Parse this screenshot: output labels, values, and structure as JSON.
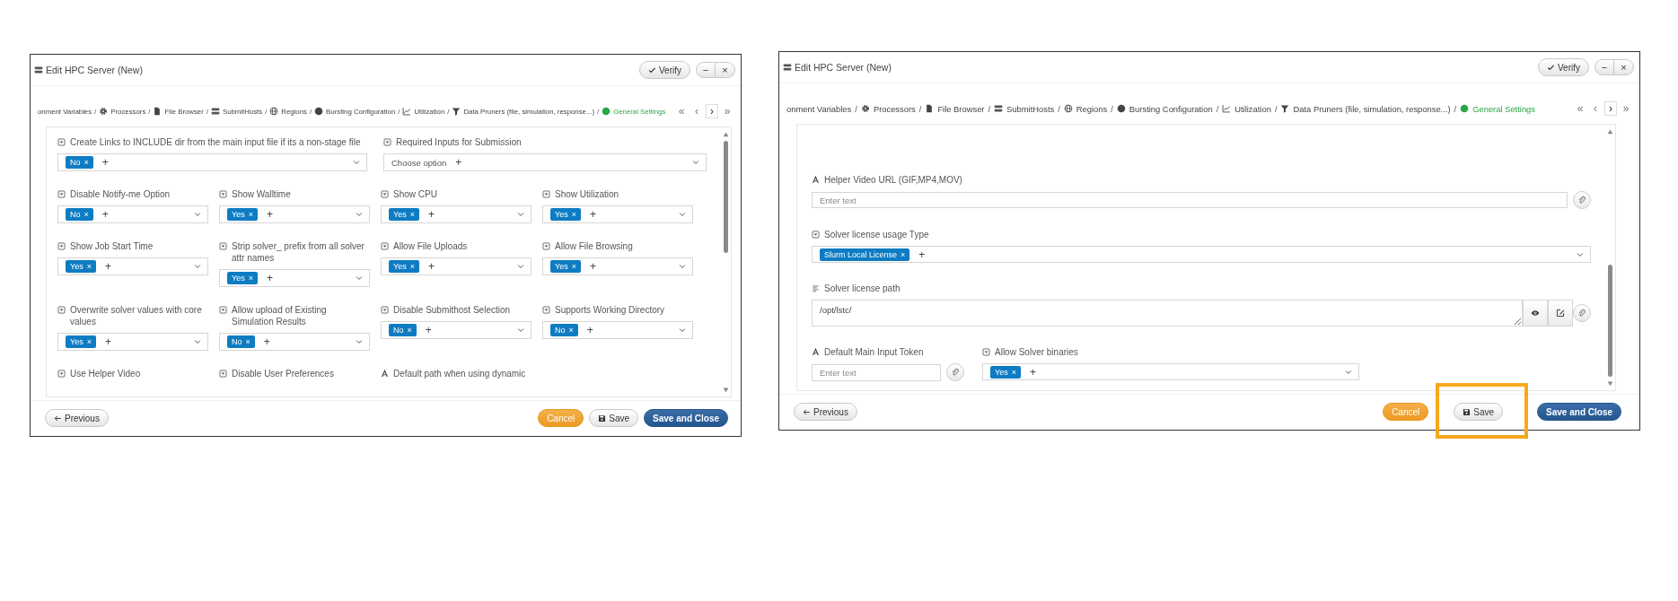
{
  "dialogs": [
    {
      "title": "Edit HPC Server (New)",
      "verify": "Verify",
      "window_controls": [
        "−",
        "×"
      ],
      "breadcrumb": [
        {
          "kind": "none",
          "label": "onment Variables",
          "separator": "/",
          "selected": false
        },
        {
          "kind": "gear",
          "label": "Processors",
          "separator": "/",
          "selected": false
        },
        {
          "kind": "file",
          "label": "File Browser",
          "separator": "/",
          "selected": false
        },
        {
          "kind": "server",
          "label": "SubmitHosts",
          "separator": "/",
          "selected": false
        },
        {
          "kind": "globe",
          "label": "Regions",
          "separator": "/",
          "selected": false
        },
        {
          "kind": "dot",
          "label": "Bursting Configuration",
          "separator": "/",
          "selected": false
        },
        {
          "kind": "chart",
          "label": "Utilization",
          "separator": "/",
          "selected": false
        },
        {
          "kind": "filter",
          "label": "Data Pruners (file, simulation, response...)",
          "separator": "/",
          "selected": false
        },
        {
          "kind": "dot",
          "label": "General Settings",
          "selected": true
        }
      ],
      "nav": [
        {
          "label": "«",
          "selected": false
        },
        {
          "label": "‹",
          "selected": false
        },
        {
          "label": "›",
          "selected": true
        },
        {
          "label": "»",
          "selected": false
        }
      ],
      "rows": [
        {
          "kind": "halves",
          "fields": [
            {
              "kind": "select",
              "label": "Create Links to INCLUDE dir from the main input file if its a non-stage file",
              "chips": [
                {
                  "label": "No",
                  "remove": "×"
                }
              ],
              "add": "+"
            },
            {
              "kind": "select",
              "label": "Required Inputs for Submission",
              "placeholder": "Choose option",
              "add": "+"
            }
          ]
        },
        {
          "kind": "quarters",
          "fields": [
            {
              "kind": "select",
              "label": "Disable Notify-me Option",
              "chips": [
                {
                  "label": "No",
                  "remove": "×"
                }
              ],
              "add": "+"
            },
            {
              "kind": "select",
              "label": "Show Walltime",
              "chips": [
                {
                  "label": "Yes",
                  "remove": "×"
                }
              ],
              "add": "+"
            },
            {
              "kind": "select",
              "label": "Show CPU",
              "chips": [
                {
                  "label": "Yes",
                  "remove": "×"
                }
              ],
              "add": "+"
            },
            {
              "kind": "select",
              "label": "Show Utilization",
              "chips": [
                {
                  "label": "Yes",
                  "remove": "×"
                }
              ],
              "add": "+"
            }
          ]
        },
        {
          "kind": "quarters",
          "fields": [
            {
              "kind": "select",
              "label": "Show Job Start Time",
              "chips": [
                {
                  "label": "Yes",
                  "remove": "×"
                }
              ],
              "add": "+"
            },
            {
              "kind": "select",
              "label": "Strip solver_ prefix from all solver attr names",
              "chips": [
                {
                  "label": "Yes",
                  "remove": "×"
                }
              ],
              "add": "+"
            },
            {
              "kind": "select",
              "label": "Allow File Uploads",
              "chips": [
                {
                  "label": "Yes",
                  "remove": "×"
                }
              ],
              "add": "+"
            },
            {
              "kind": "select",
              "label": "Allow File Browsing",
              "chips": [
                {
                  "label": "Yes",
                  "remove": "×"
                }
              ],
              "add": "+"
            }
          ]
        },
        {
          "kind": "quarters",
          "fields": [
            {
              "kind": "select",
              "label": "Overwrite solver values with core values",
              "chips": [
                {
                  "label": "Yes",
                  "remove": "×"
                }
              ],
              "add": "+"
            },
            {
              "kind": "select",
              "label": "Allow upload of Existing Simulation Results",
              "chips": [
                {
                  "label": "No",
                  "remove": "×"
                }
              ],
              "add": "+"
            },
            {
              "kind": "select",
              "label": "Disable Submithost Selection",
              "chips": [
                {
                  "label": "No",
                  "remove": "×"
                }
              ],
              "add": "+"
            },
            {
              "kind": "select",
              "label": "Supports Working Directory",
              "chips": [
                {
                  "label": "No",
                  "remove": "×"
                }
              ],
              "add": "+"
            }
          ]
        },
        {
          "kind": "quarters",
          "fields": [
            {
              "kind": "select",
              "label": "Use Helper Video"
            },
            {
              "kind": "select",
              "label": "Disable User Preferences"
            },
            {
              "kind": "text",
              "label": "Default path when using dynamic"
            }
          ]
        }
      ],
      "footer": {
        "previous": "Previous",
        "cancel": "Cancel",
        "save": {
          "label": "Save",
          "highlighted": false
        },
        "save_close": "Save and Close"
      }
    },
    {
      "title": "Edit HPC Server (New)",
      "verify": "Verify",
      "window_controls": [
        "−",
        "×"
      ],
      "breadcrumb": [
        {
          "kind": "none",
          "label": "onment Variables",
          "separator": "/",
          "selected": false
        },
        {
          "kind": "gear",
          "label": "Processors",
          "separator": "/",
          "selected": false
        },
        {
          "kind": "file",
          "label": "File Browser",
          "separator": "/",
          "selected": false
        },
        {
          "kind": "server",
          "label": "SubmitHosts",
          "separator": "/",
          "selected": false
        },
        {
          "kind": "globe",
          "label": "Regions",
          "separator": "/",
          "selected": false
        },
        {
          "kind": "dot",
          "label": "Bursting Configuration",
          "separator": "/",
          "selected": false
        },
        {
          "kind": "chart",
          "label": "Utilization",
          "separator": "/",
          "selected": false
        },
        {
          "kind": "filter",
          "label": "Data Pruners (file, simulation, response...)",
          "separator": "/",
          "selected": false
        },
        {
          "kind": "dot",
          "label": "General Settings",
          "selected": true
        }
      ],
      "nav": [
        {
          "label": "«",
          "selected": false
        },
        {
          "label": "‹",
          "selected": false
        },
        {
          "label": "›",
          "selected": true
        },
        {
          "label": "»",
          "selected": false
        }
      ],
      "rows": [
        {
          "kind": "full",
          "fields": [
            {
              "kind": "text",
              "label": "Helper Video URL (GIF,MP4,MOV)",
              "placeholder": "Enter text"
            }
          ]
        },
        {
          "kind": "full",
          "fields": [
            {
              "kind": "select",
              "label": "Solver license usage Type",
              "chips": [
                {
                  "label": "Slurm Local License",
                  "remove": "×"
                }
              ],
              "add": "+"
            }
          ]
        },
        {
          "kind": "full",
          "fields": [
            {
              "kind": "textarea",
              "label": "Solver license path",
              "value": "/opt/lstc/"
            }
          ]
        },
        {
          "kind": "mixed",
          "fields": [
            {
              "kind": "text",
              "label": "Default Main Input Token",
              "placeholder": "Enter text"
            },
            {
              "kind": "select",
              "label": "Allow Solver binaries",
              "chips": [
                {
                  "label": "Yes",
                  "remove": "×"
                }
              ],
              "add": "+"
            }
          ]
        }
      ],
      "footer": {
        "previous": "Previous",
        "cancel": "Cancel",
        "save": {
          "label": "Save",
          "highlighted": true
        },
        "save_close": "Save and Close"
      }
    }
  ]
}
